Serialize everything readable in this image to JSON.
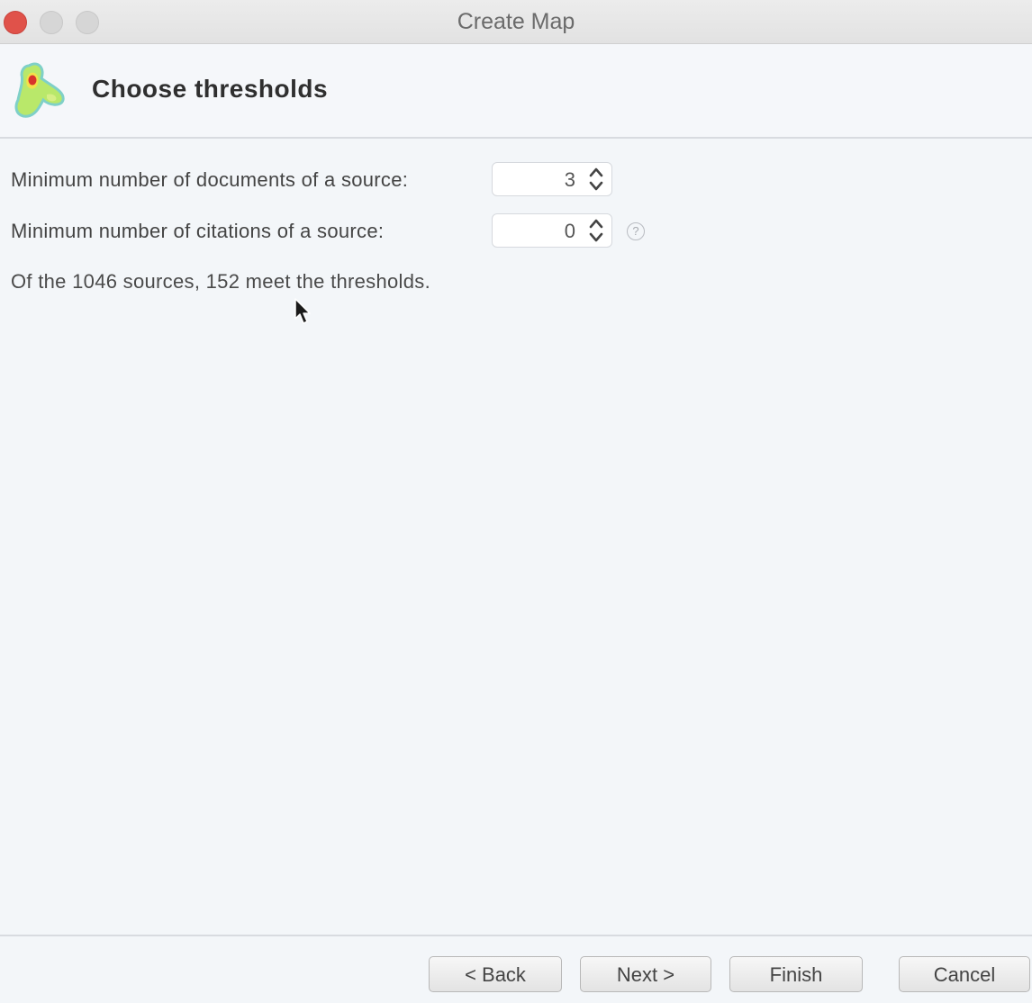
{
  "window": {
    "title": "Create Map"
  },
  "header": {
    "title": "Choose thresholds",
    "logo_icon": "vosviewer-logo-icon"
  },
  "form": {
    "min_documents": {
      "label": "Minimum number of documents of a source:",
      "value": "3"
    },
    "min_citations": {
      "label": "Minimum number of citations of a source:",
      "value": "0",
      "help_icon": "?"
    },
    "summary": "Of the 1046 sources, 152 meet the thresholds."
  },
  "buttons": {
    "back": "< Back",
    "next": "Next >",
    "finish": "Finish",
    "cancel": "Cancel"
  },
  "colors": {
    "close_button": "#e0524a",
    "background": "#f3f6f9"
  }
}
